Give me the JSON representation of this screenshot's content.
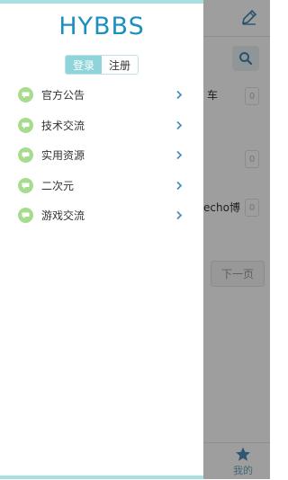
{
  "drawer": {
    "brand": "HYBBS",
    "auth": {
      "login": "登录",
      "register": "注册"
    },
    "menu": [
      {
        "label": "官方公告",
        "icon": "chat-bubble-icon"
      },
      {
        "label": "技术交流",
        "icon": "chat-bubble-icon"
      },
      {
        "label": "实用资源",
        "icon": "chat-bubble-icon"
      },
      {
        "label": "二次元",
        "icon": "chat-bubble-icon"
      },
      {
        "label": "游戏交流",
        "icon": "chat-bubble-icon"
      }
    ],
    "arrow_icon": "chevron-right-icon"
  },
  "app": {
    "rows": [
      {
        "text": "车",
        "count": "0"
      },
      {
        "text": "",
        "count": "0"
      },
      {
        "text": "echo博",
        "count": "0"
      }
    ],
    "next_page": "下一页",
    "tab_my": "我的",
    "icons": {
      "edit": "edit-pen-icon",
      "search": "search-icon",
      "tab_my": "star-icon"
    }
  },
  "colors": {
    "brand": "#1b8fbe",
    "accent": "#a6e0e0",
    "login_bg": "#8fd4d9",
    "menu_icon": "#a7dc8f",
    "arrow": "#4d8dbb"
  }
}
